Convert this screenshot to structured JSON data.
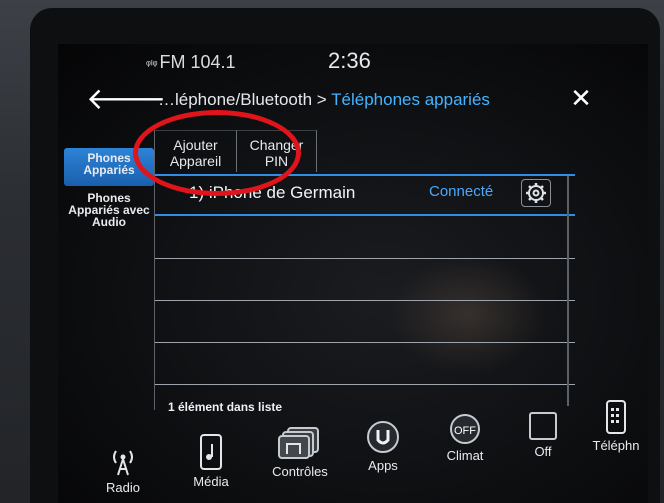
{
  "status_bar": {
    "radio": "FM 104.1",
    "time": "2:36"
  },
  "header": {
    "breadcrumb_parent": "…léphone/Bluetooth",
    "breadcrumb_separator": " > ",
    "breadcrumb_current": "Téléphones appariés",
    "accent": "#46b3ff"
  },
  "side_tabs": [
    {
      "label": "Phones Appariés"
    },
    {
      "label": "Phones Appariés avec Audio"
    }
  ],
  "toolbar": {
    "add_label": "Ajouter Appareil",
    "change_pin_label": "Changer PIN"
  },
  "devices": [
    {
      "name": "1) iPhone de Germain",
      "status": "Connecté"
    }
  ],
  "list_count": "1 élément dans liste",
  "dock": [
    {
      "label": "Radio",
      "icon": "radio-antenna-icon"
    },
    {
      "label": "Média",
      "icon": "media-phone-icon"
    },
    {
      "label": "Contrôles",
      "icon": "controls-icon"
    },
    {
      "label": "Apps",
      "icon": "apps-icon"
    },
    {
      "label": "Climat",
      "icon": "climate-icon",
      "badge": "OFF"
    },
    {
      "label": "Off",
      "icon": "screen-off-icon"
    },
    {
      "label": "Téléphn",
      "icon": "phone-icon"
    }
  ],
  "annotation_color": "#e0141b"
}
